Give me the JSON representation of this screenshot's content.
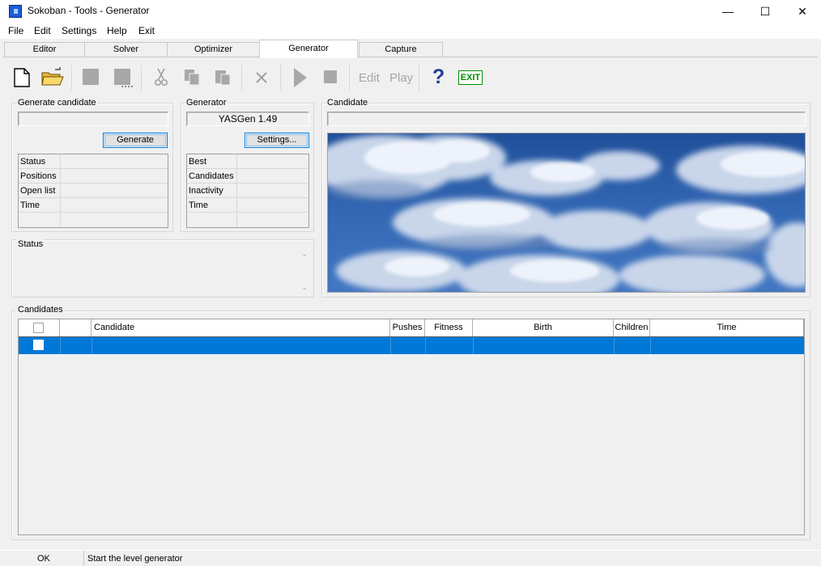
{
  "window": {
    "title": "Sokoban - Tools - Generator",
    "minimize": "—",
    "maximize": "☐",
    "close": "✕"
  },
  "menu": [
    "File",
    "Edit",
    "Settings",
    "Help",
    "Exit"
  ],
  "tabs": [
    "Editor",
    "Solver",
    "Optimizer",
    "Generator",
    "Capture"
  ],
  "active_tab": "Generator",
  "toolbar": {
    "edit_label": "Edit",
    "play_label": "Play",
    "help_glyph": "?",
    "exit_label": "EXIT"
  },
  "generate_candidate": {
    "title": "Generate candidate",
    "field_value": "",
    "button": "Generate",
    "rows": [
      "Status",
      "Positions",
      "Open list",
      "Time",
      ""
    ]
  },
  "generator": {
    "title": "Generator",
    "version": "YASGen 1.49",
    "button": "Settings...",
    "rows": [
      "Best",
      "Candidates",
      "Inactivity",
      "Time",
      ""
    ]
  },
  "candidate_panel": {
    "title": "Candidate",
    "field_value": ""
  },
  "status_panel": {
    "title": "Status"
  },
  "candidates_table": {
    "title": "Candidates",
    "columns": [
      "",
      "",
      "Candidate",
      "Pushes",
      "Fitness",
      "Birth",
      "Children",
      "Time"
    ],
    "selected_row_color": "#0078d7"
  },
  "statusbar": {
    "left": "OK",
    "message": "Start the level generator"
  },
  "colors": {
    "accent": "#0078d7",
    "exit_green": "#008a00",
    "help_blue": "#1c3f94"
  }
}
